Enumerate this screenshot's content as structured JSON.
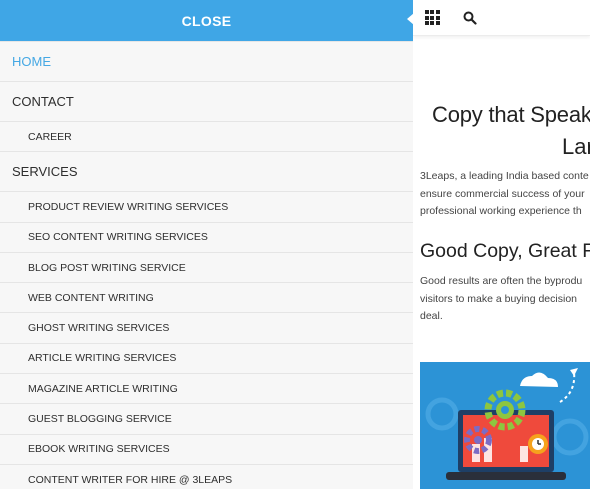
{
  "menu": {
    "close_label": "CLOSE",
    "items": [
      {
        "label": "HOME",
        "level": "top",
        "active": true
      },
      {
        "label": "CONTACT",
        "level": "top"
      },
      {
        "label": "CAREER",
        "level": "sub"
      },
      {
        "label": "SERVICES",
        "level": "top"
      },
      {
        "label": "PRODUCT REVIEW WRITING SERVICES",
        "level": "sub"
      },
      {
        "label": "SEO CONTENT WRITING SERVICES",
        "level": "sub"
      },
      {
        "label": "BLOG POST WRITING SERVICE",
        "level": "sub"
      },
      {
        "label": "WEB CONTENT WRITING",
        "level": "sub"
      },
      {
        "label": "GHOST WRITING SERVICES",
        "level": "sub"
      },
      {
        "label": "ARTICLE WRITING SERVICES",
        "level": "sub"
      },
      {
        "label": "MAGAZINE ARTICLE WRITING",
        "level": "sub"
      },
      {
        "label": "GUEST BLOGGING SERVICE",
        "level": "sub"
      },
      {
        "label": "EBOOK WRITING SERVICES",
        "level": "sub"
      },
      {
        "label": "CONTENT WRITER FOR HIRE @ 3LEAPS",
        "level": "sub"
      }
    ]
  },
  "topbar": {
    "apps_icon": "grid-icon",
    "search_icon": "search-icon"
  },
  "content": {
    "hero_line1": "Copy that Speak",
    "hero_line2": "Lar",
    "intro_lines": [
      "3Leaps, a leading India based conte",
      "ensure commercial success of your",
      "professional working experience th"
    ],
    "heading2": "Good Copy, Great Fo",
    "body_lines": [
      "Good results are often the byprodu",
      "visitors to make a buying decision",
      "deal."
    ]
  },
  "colors": {
    "accent": "#3fa6e6",
    "active_link": "#45a8e4",
    "illustration_bg": "#2c93d6"
  }
}
